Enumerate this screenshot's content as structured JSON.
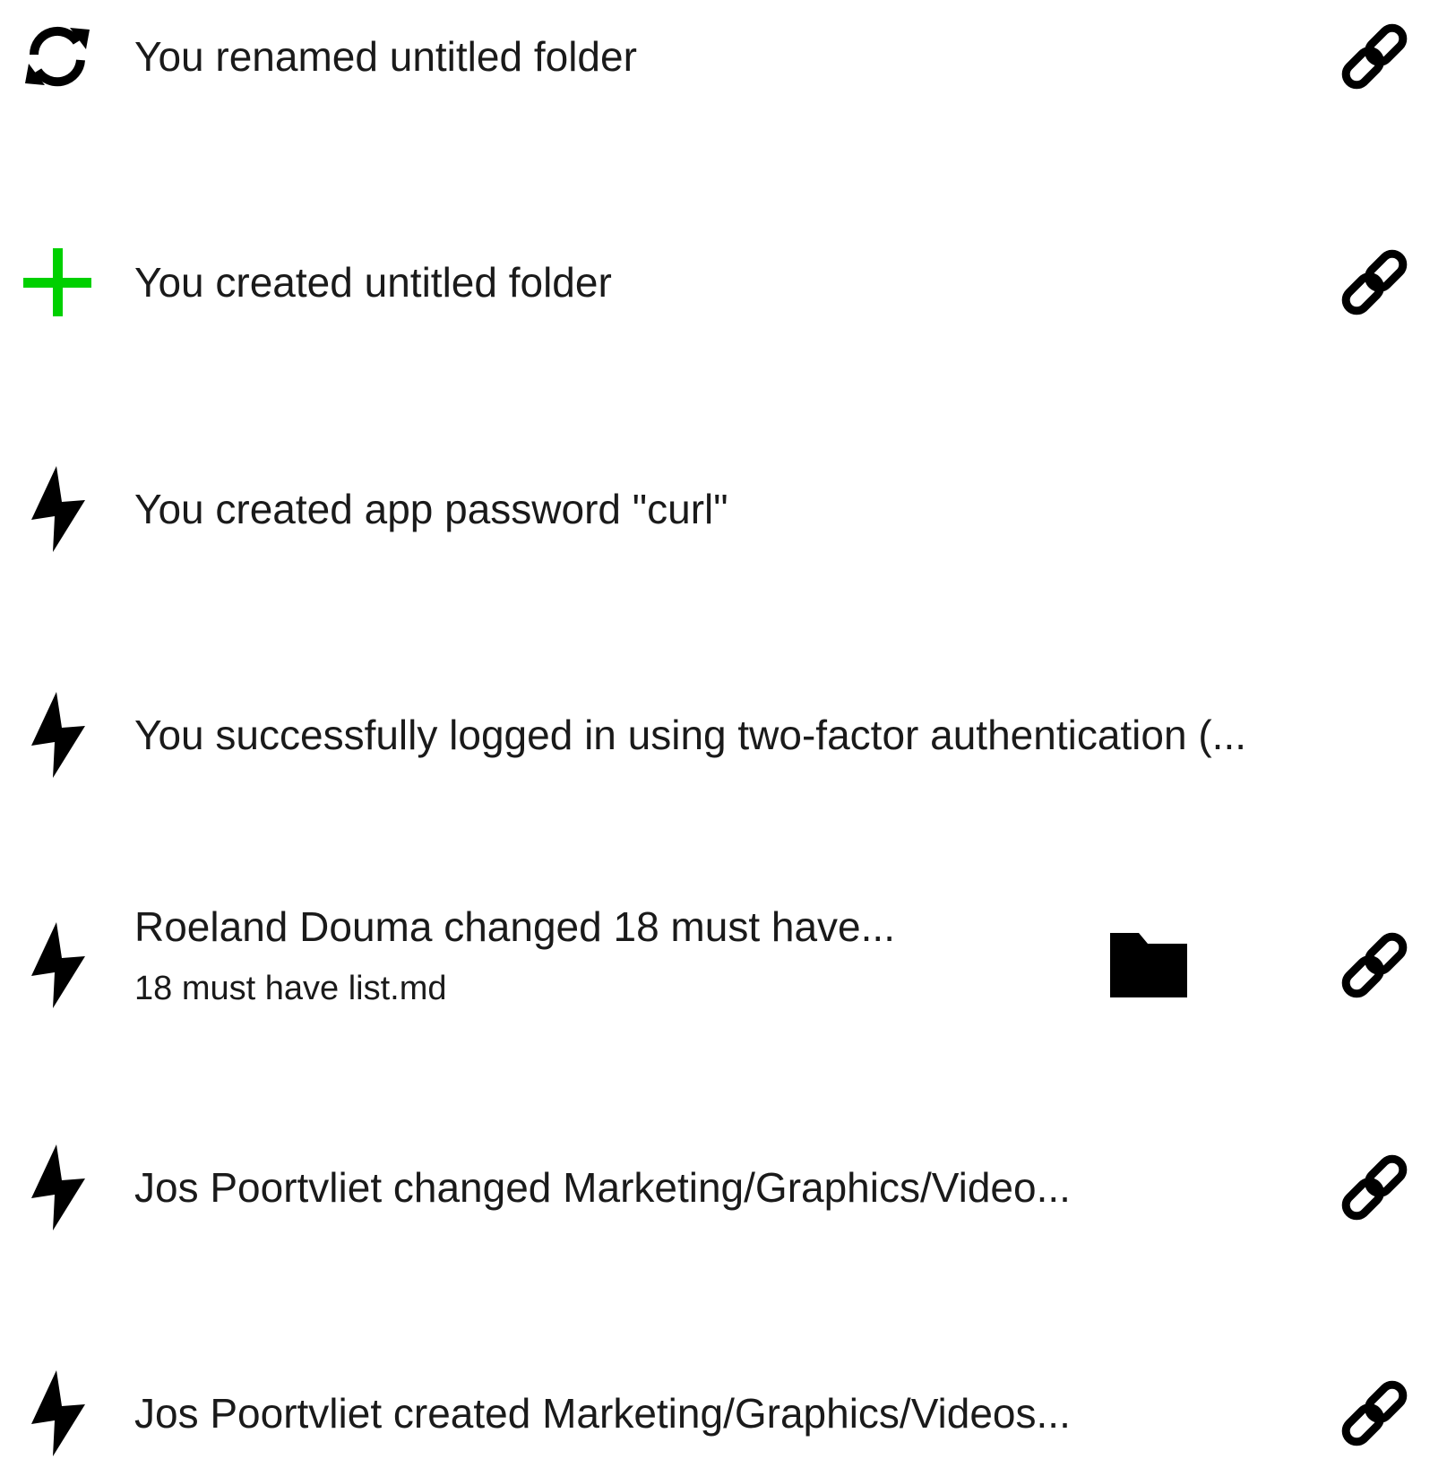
{
  "colors": {
    "text": "#1a1a1a",
    "icon_default": "#000000",
    "icon_created": "#00d000"
  },
  "activities": [
    {
      "icon": "sync-icon",
      "title": "You renamed untitled folder",
      "subtitle": "",
      "has_share_link": true,
      "has_preview": false
    },
    {
      "icon": "plus-icon",
      "title": "You created untitled folder",
      "subtitle": "",
      "has_share_link": true,
      "has_preview": false
    },
    {
      "icon": "bolt-icon",
      "title": "You created app password \"curl\"",
      "subtitle": "",
      "has_share_link": false,
      "has_preview": false
    },
    {
      "icon": "bolt-icon",
      "title": "You successfully logged in using two-factor authentication (...",
      "subtitle": "",
      "has_share_link": false,
      "has_preview": false
    },
    {
      "icon": "bolt-icon",
      "title": "Roeland Douma changed 18 must have...",
      "subtitle": "18 must have list.md",
      "has_share_link": true,
      "has_preview": true,
      "preview_icon": "folder-icon"
    },
    {
      "icon": "bolt-icon",
      "title": "Jos Poortvliet changed Marketing/Graphics/Video...",
      "subtitle": "",
      "has_share_link": true,
      "has_preview": false
    },
    {
      "icon": "bolt-icon",
      "title": "Jos Poortvliet created Marketing/Graphics/Videos...",
      "subtitle": "",
      "has_share_link": true,
      "has_preview": false
    }
  ]
}
